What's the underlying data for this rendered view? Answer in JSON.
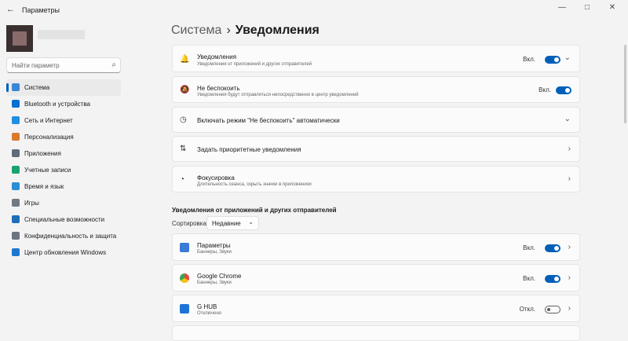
{
  "window": {
    "title": "Параметры",
    "back_icon": "←",
    "minimize": "—",
    "maximize": "□",
    "close": "✕"
  },
  "search": {
    "placeholder": "Найти параметр"
  },
  "sidebar": {
    "items": [
      {
        "label": "Система",
        "icon": "system-icon",
        "color": "#3a86d6",
        "active": true
      },
      {
        "label": "Bluetooth и устройства",
        "icon": "bluetooth-icon",
        "color": "#0a6fd1"
      },
      {
        "label": "Сеть и Интернет",
        "icon": "wifi-icon",
        "color": "#1f8fe0"
      },
      {
        "label": "Персонализация",
        "icon": "brush-icon",
        "color": "#d97b2b"
      },
      {
        "label": "Приложения",
        "icon": "apps-icon",
        "color": "#606a78"
      },
      {
        "label": "Учетные записи",
        "icon": "account-icon",
        "color": "#1aa36f"
      },
      {
        "label": "Время и язык",
        "icon": "globe-clock-icon",
        "color": "#2b8fd6"
      },
      {
        "label": "Игры",
        "icon": "gamepad-icon",
        "color": "#707a86"
      },
      {
        "label": "Специальные возможности",
        "icon": "accessibility-icon",
        "color": "#1e6fb8"
      },
      {
        "label": "Конфиденциальность и защита",
        "icon": "shield-icon",
        "color": "#6b7480"
      },
      {
        "label": "Центр обновления Windows",
        "icon": "update-icon",
        "color": "#1d78d0"
      }
    ]
  },
  "breadcrumb": {
    "parent": "Система",
    "separator": "›",
    "current": "Уведомления"
  },
  "settings": [
    {
      "title": "Уведомления",
      "subtitle": "Уведомления от приложений и других отправителей",
      "state": "Вкл.",
      "toggle": "on",
      "icon": "bell-icon",
      "glyph": "🔔",
      "chevron": "⌄"
    },
    {
      "title": "Не беспокоить",
      "subtitle": "Уведомления будут отправляться непосредственно в центр уведомлений",
      "state": "Вкл.",
      "toggle": "on",
      "icon": "bell-snooze-icon",
      "glyph": "🔕"
    },
    {
      "title": "Включать режим \"Не беспокоить\" автоматически",
      "icon": "clock-icon",
      "glyph": "◷",
      "chevron": "⌄"
    },
    {
      "title": "Задать приоритетные уведомления",
      "icon": "priority-sort-icon",
      "glyph": "⇅",
      "chevron": "›"
    },
    {
      "title": "Фокусировка",
      "subtitle": "Длительность сеанса, скрыть значки в приложениях",
      "icon": "focus-icon",
      "glyph": "◔",
      "chevron": "›"
    }
  ],
  "apps_section": {
    "title": "Уведомления от приложений и других отправителей",
    "sort_label": "Сортировка:",
    "sort_value": "Недавние",
    "sort_chevron": "⌄",
    "apps": [
      {
        "name": "Параметры",
        "subtitle": "Баннеры, Звуки",
        "state": "Вкл.",
        "toggle": "on",
        "icon": "settings-app-icon",
        "color": "#3a7bd5"
      },
      {
        "name": "Google Chrome",
        "subtitle": "Баннеры, Звуки",
        "state": "Вкл.",
        "toggle": "on",
        "icon": "chrome-icon",
        "color": "#e8453c"
      },
      {
        "name": "G HUB",
        "subtitle": "Отключено",
        "state": "Откл.",
        "toggle": "off",
        "icon": "ghub-icon",
        "color": "#1e73d9"
      }
    ]
  }
}
